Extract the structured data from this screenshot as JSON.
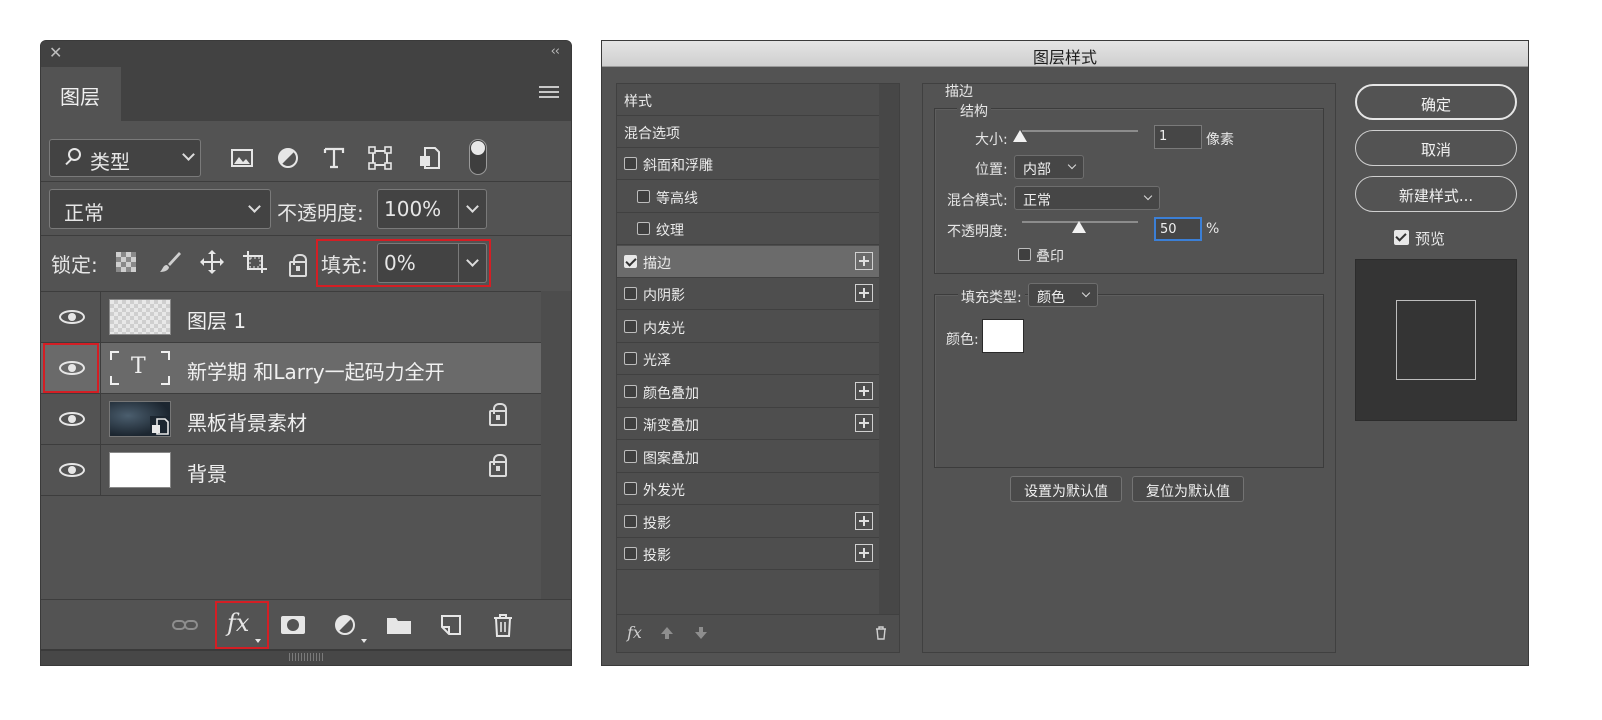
{
  "layers_panel": {
    "tab": "图层",
    "filter_kind": "类型",
    "blend_mode": "正常",
    "opacity_label": "不透明度:",
    "opacity_value": "100%",
    "lock_label": "锁定:",
    "fill_label": "填充:",
    "fill_value": "0%",
    "layers": [
      {
        "name": "图层 1",
        "thumb": "transparent"
      },
      {
        "name": "新学期 和Larry一起码力全开",
        "thumb": "text",
        "text_glyph": "T"
      },
      {
        "name": "黑板背景素材",
        "thumb": "smart-object",
        "locked": true
      },
      {
        "name": "背景",
        "thumb": "white",
        "locked": true
      }
    ],
    "fx_label": "fx",
    "highlight_color": "#d41e24"
  },
  "dialog": {
    "title": "图层样式",
    "styles_header": "样式",
    "blend_options": "混合选项",
    "styles": [
      {
        "label": "斜面和浮雕",
        "checked": false,
        "indent": false,
        "plus": false
      },
      {
        "label": "等高线",
        "checked": false,
        "indent": true,
        "plus": false
      },
      {
        "label": "纹理",
        "checked": false,
        "indent": true,
        "plus": false
      },
      {
        "label": "描边",
        "checked": true,
        "indent": false,
        "plus": true,
        "selected": true
      },
      {
        "label": "内阴影",
        "checked": false,
        "indent": false,
        "plus": true
      },
      {
        "label": "内发光",
        "checked": false,
        "indent": false,
        "plus": false
      },
      {
        "label": "光泽",
        "checked": false,
        "indent": false,
        "plus": false
      },
      {
        "label": "颜色叠加",
        "checked": false,
        "indent": false,
        "plus": true
      },
      {
        "label": "渐变叠加",
        "checked": false,
        "indent": false,
        "plus": true
      },
      {
        "label": "图案叠加",
        "checked": false,
        "indent": false,
        "plus": false
      },
      {
        "label": "外发光",
        "checked": false,
        "indent": false,
        "plus": false
      },
      {
        "label": "投影",
        "checked": false,
        "indent": false,
        "plus": true
      },
      {
        "label": "投影",
        "checked": false,
        "indent": false,
        "plus": true
      }
    ],
    "footer_fx": "fx",
    "stroke": {
      "section": "描边",
      "structure": "结构",
      "size_label": "大小:",
      "size_value": "1",
      "size_unit": "像素",
      "position_label": "位置:",
      "position_value": "内部",
      "blend_label": "混合模式:",
      "blend_value": "正常",
      "opacity_label": "不透明度:",
      "opacity_value": "50",
      "opacity_unit": "%",
      "overprint_label": "叠印",
      "fill_type_label": "填充类型:",
      "fill_type_value": "颜色",
      "color_label": "颜色:",
      "color_value": "#ffffff",
      "set_default": "设置为默认值",
      "reset_default": "复位为默认值"
    },
    "buttons": {
      "ok": "确定",
      "cancel": "取消",
      "new_style": "新建样式...",
      "preview": "预览"
    }
  }
}
